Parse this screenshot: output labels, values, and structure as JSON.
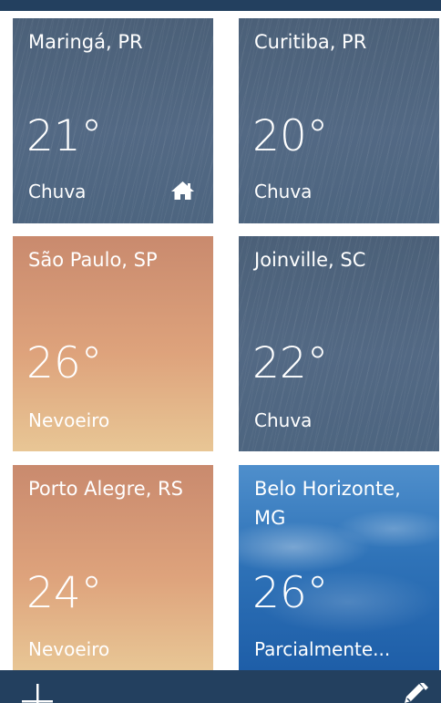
{
  "tiles": [
    {
      "city": "Maringá, PR",
      "temp": "21°",
      "condition": "Chuva",
      "style": "rain",
      "home": true
    },
    {
      "city": "Curitiba, PR",
      "temp": "20°",
      "condition": "Chuva",
      "style": "rain",
      "home": false
    },
    {
      "city": "São Paulo, SP",
      "temp": "26°",
      "condition": "Nevoeiro",
      "style": "fog",
      "home": false
    },
    {
      "city": "Joinville, SC",
      "temp": "22°",
      "condition": "Chuva",
      "style": "rain",
      "home": false
    },
    {
      "city": "Porto Alegre, RS",
      "temp": "24°",
      "condition": "Nevoeiro",
      "style": "fog",
      "home": false
    },
    {
      "city": "Belo Horizonte, MG",
      "temp": "26°",
      "condition": "Parcialmente...",
      "style": "cloud",
      "home": false
    }
  ],
  "colors": {
    "appbar": "#23405f",
    "rain": "#4e657f",
    "fog": "#d99b78",
    "cloud": "#2f73b8"
  },
  "icons": {
    "home": "home-icon",
    "add": "add-icon",
    "edit": "edit-icon"
  }
}
